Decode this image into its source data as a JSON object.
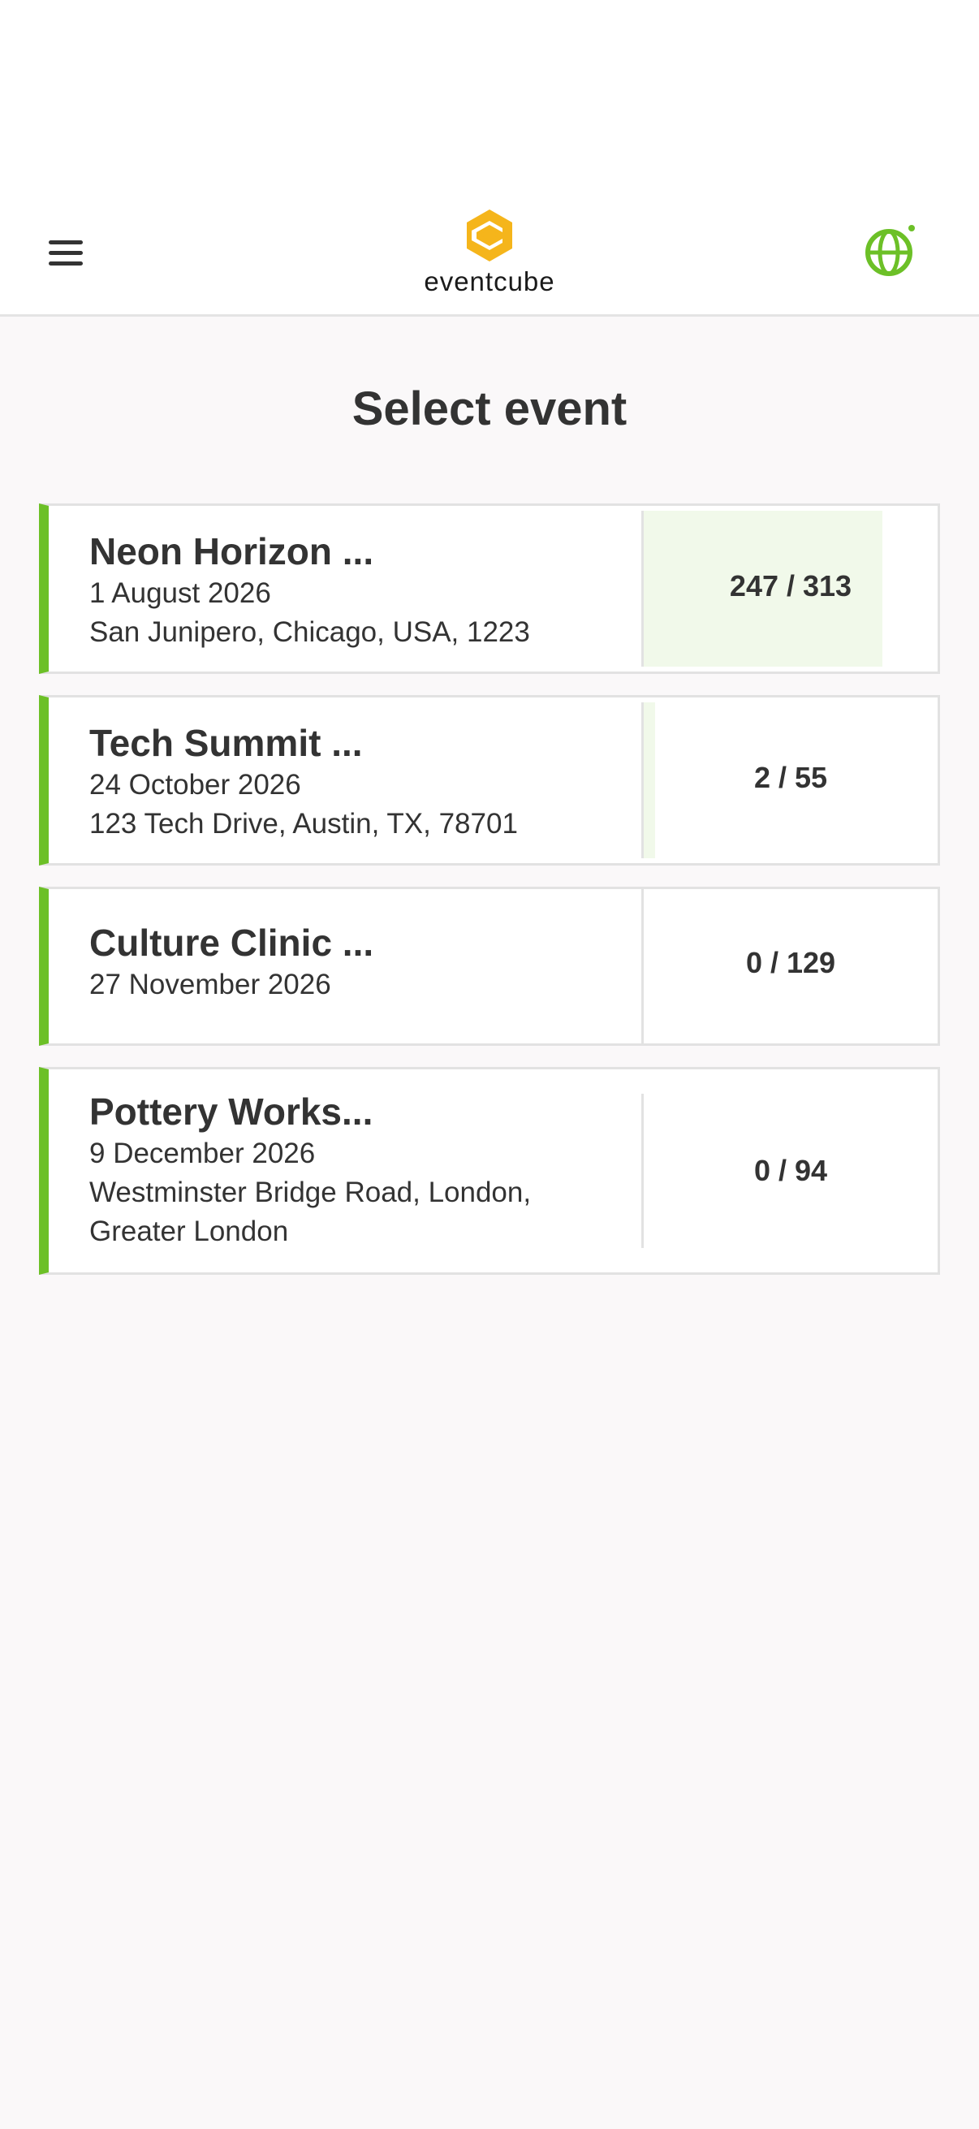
{
  "header": {
    "logo_text": "eventcube",
    "menu_icon": "hamburger-menu-icon",
    "globe_icon": "globe-icon",
    "accent_color": "#6cc027",
    "logo_color": "#f5b51b"
  },
  "page": {
    "title": "Select event"
  },
  "events": [
    {
      "title": "Neon Horizon ...",
      "date": "1 August 2026",
      "location": "San Junipero, Chicago, USA, 1223",
      "location2": "",
      "counter": "247 / 313",
      "sold": 247,
      "capacity": 313
    },
    {
      "title": "Tech Summit ...",
      "date": "24 October 2026",
      "location": "123 Tech Drive, Austin, TX, 78701",
      "location2": "",
      "counter": "2 / 55",
      "sold": 2,
      "capacity": 55
    },
    {
      "title": "Culture Clinic ...",
      "date": "27 November 2026",
      "location": "",
      "location2": "",
      "counter": "0 / 129",
      "sold": 0,
      "capacity": 129
    },
    {
      "title": "Pottery Works...",
      "date": "9 December 2026",
      "location": "Westminster Bridge Road, London,",
      "location2": "Greater London",
      "counter": "0 / 94",
      "sold": 0,
      "capacity": 94
    }
  ]
}
